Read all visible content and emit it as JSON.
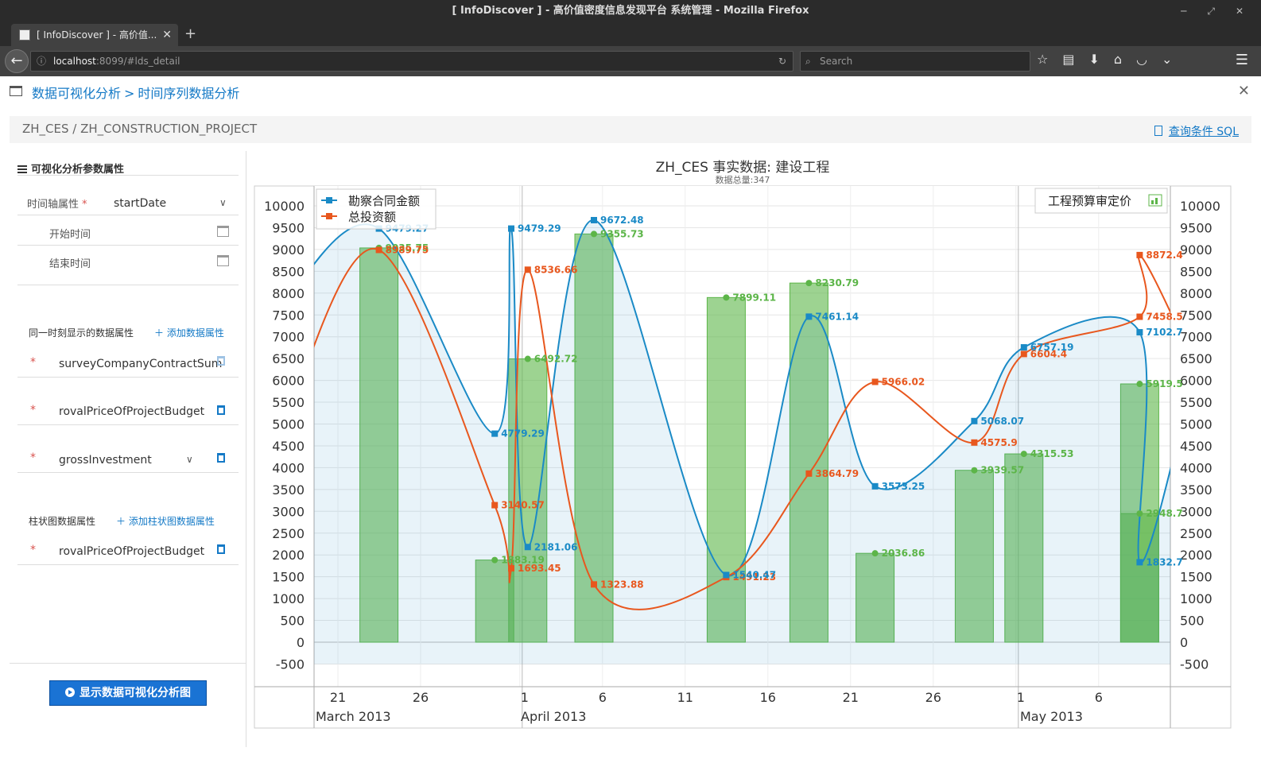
{
  "browser": {
    "window_title": "[ InfoDiscover ] - 高价值密度信息发现平台 系统管理 - Mozilla Firefox",
    "tab_title": "[ InfoDiscover ] - 高价值...",
    "url_host": "localhost",
    "url_rest": ":8099/#lds_detail",
    "search_placeholder": "Search"
  },
  "page": {
    "crumb1": "数据可视化分析",
    "crumb_sep": ">",
    "crumb2": "时间序列数据分析",
    "path": "ZH_CES / ZH_CONSTRUCTION_PROJECT",
    "sql_link": "查询条件 SQL"
  },
  "panel": {
    "title": "可视化分析参数属性",
    "time_axis_label": "时间轴属性",
    "time_axis_value": "startDate",
    "start_label": "开始时间",
    "end_label": "结束时间",
    "same_time_label": "同一时刻显示的数据属性",
    "add_data_attr": "添加数据属性",
    "data_attrs": [
      "surveyCompanyContractSum",
      "rovalPriceOfProjectBudget",
      "grossInvestment"
    ],
    "bar_label": "柱状图数据属性",
    "add_bar_attr": "添加柱状图数据属性",
    "bar_attrs": [
      "rovalPriceOfProjectBudget"
    ],
    "show_button": "显示数据可视化分析图"
  },
  "chart_data": {
    "type": "line",
    "title": "ZH_CES 事实数据: 建设工程",
    "subtitle": "数据总量:347",
    "ylim": [
      -500,
      10000
    ],
    "y_ticks": [
      10000,
      9500,
      9000,
      8500,
      8000,
      7500,
      7000,
      6500,
      6000,
      5500,
      5000,
      4500,
      4000,
      3500,
      3000,
      2500,
      2000,
      1500,
      1000,
      500,
      0,
      -500
    ],
    "x_ticks": [
      "21",
      "26",
      "1",
      "6",
      "11",
      "16",
      "21",
      "26",
      "1",
      "6"
    ],
    "x_months": [
      "March 2013",
      "April 2013",
      "May 2013"
    ],
    "legend_left": [
      "勘察合同金额",
      "总投资额"
    ],
    "legend_right": [
      "工程预算审定价"
    ],
    "colors": {
      "survey": "#1a8ac6",
      "gross": "#e8571e",
      "bar": "#5cb548"
    },
    "series": [
      {
        "name": "勘察合同金额",
        "dates": [
          "2013-03-23",
          "2013-03-30",
          "2013-03-31",
          "2013-04-01",
          "2013-04-05",
          "2013-04-13",
          "2013-04-18",
          "2013-04-22",
          "2013-04-28",
          "2013-05-01",
          "2013-05-08",
          "2013-05-08"
        ],
        "values": [
          9479.27,
          4779.29,
          9479.29,
          2181.06,
          9672.48,
          1540.47,
          7461.14,
          3573.25,
          5068.07,
          6757.19,
          7102.7,
          1832.7
        ]
      },
      {
        "name": "总投资额",
        "dates": [
          "2013-03-23",
          "2013-03-30",
          "2013-03-31",
          "2013-04-01",
          "2013-04-05",
          "2013-04-13",
          "2013-04-18",
          "2013-04-22",
          "2013-04-28",
          "2013-05-01",
          "2013-05-08",
          "2013-05-08"
        ],
        "values": [
          8989.75,
          3140.57,
          1693.45,
          8536.66,
          1323.88,
          1491.23,
          3864.79,
          5966.02,
          4575.9,
          6604.4,
          7458.5,
          8872.4
        ]
      },
      {
        "name": "工程预算审定价",
        "dates": [
          "2013-03-23",
          "2013-03-30",
          "2013-04-01",
          "2013-04-05",
          "2013-04-13",
          "2013-04-18",
          "2013-04-22",
          "2013-04-28",
          "2013-05-01",
          "2013-05-08",
          "2013-05-08"
        ],
        "values": [
          9035.75,
          1883.19,
          6492.72,
          9355.73,
          7899.11,
          8230.79,
          2036.86,
          3939.57,
          4315.53,
          5919.5,
          2948.7
        ]
      }
    ]
  }
}
